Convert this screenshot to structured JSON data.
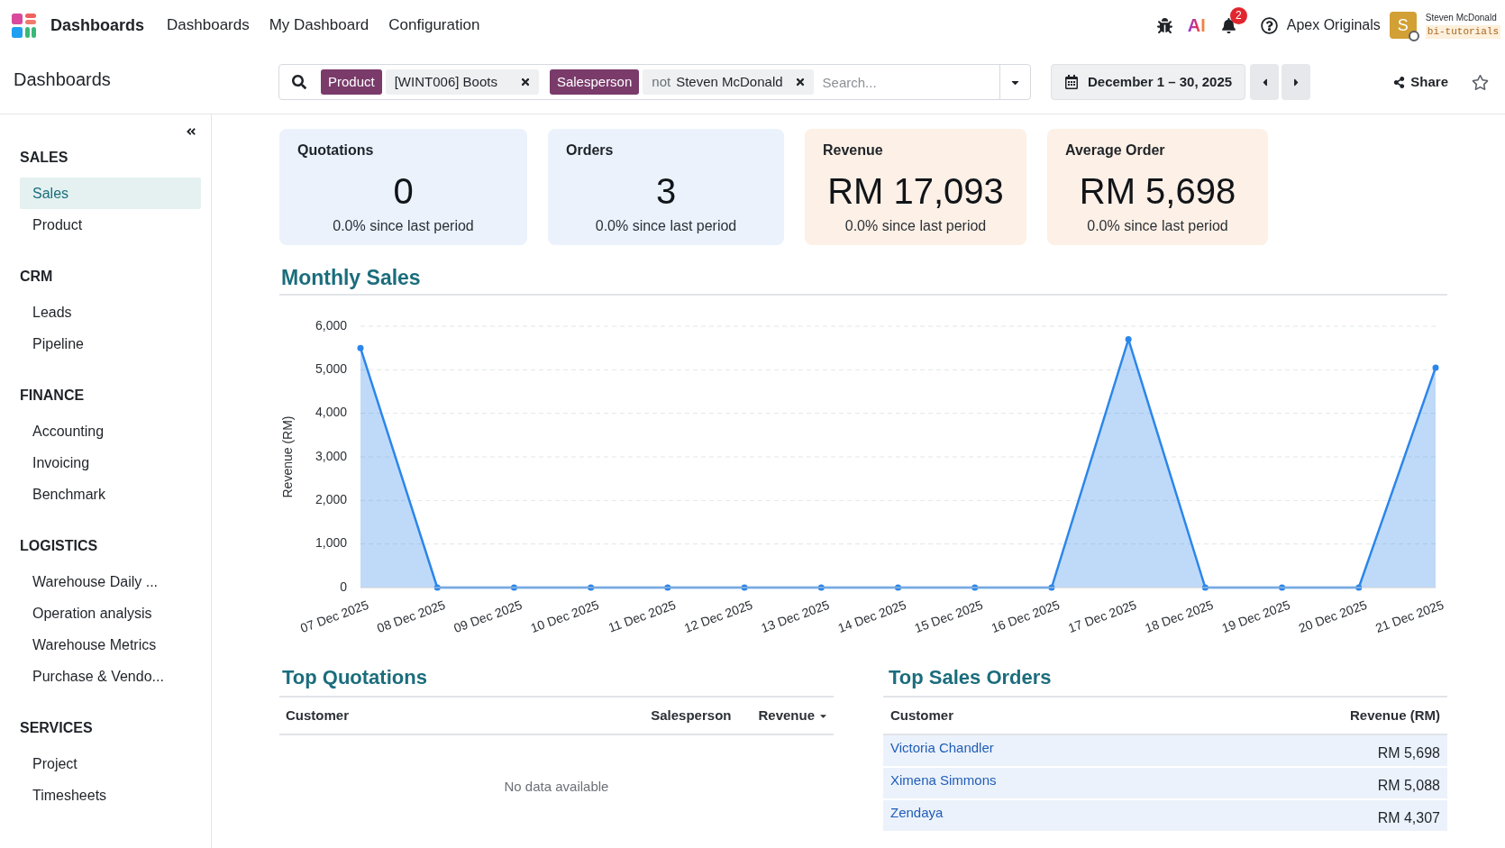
{
  "top_nav": {
    "app_title": "Dashboards",
    "menu": [
      "Dashboards",
      "My Dashboard",
      "Configuration"
    ],
    "ai_label": "AI",
    "notification_count": "2",
    "company": "Apex Originals",
    "user": {
      "avatar_letter": "S",
      "name": "Steven McDonald",
      "database": "bi-tutorials"
    }
  },
  "control_panel": {
    "breadcrumb": "Dashboards",
    "search": {
      "facets": [
        {
          "field": "Product",
          "value": "[WINT006] Boots"
        },
        {
          "field": "Salesperson",
          "operator": "not",
          "value": "Steven McDonald"
        }
      ],
      "placeholder": "Search..."
    },
    "date_range": "December 1 – 30, 2025",
    "share": "Share",
    "starred": false
  },
  "sidebar": {
    "sections": [
      {
        "title": "SALES",
        "items": [
          {
            "label": "Sales",
            "selected": true
          },
          {
            "label": "Product",
            "selected": false
          }
        ]
      },
      {
        "title": "CRM",
        "items": [
          {
            "label": "Leads",
            "selected": false
          },
          {
            "label": "Pipeline",
            "selected": false
          }
        ]
      },
      {
        "title": "FINANCE",
        "items": [
          {
            "label": "Accounting",
            "selected": false
          },
          {
            "label": "Invoicing",
            "selected": false
          },
          {
            "label": "Benchmark",
            "selected": false
          }
        ]
      },
      {
        "title": "LOGISTICS",
        "items": [
          {
            "label": "Warehouse Daily ...",
            "selected": false
          },
          {
            "label": "Operation analysis",
            "selected": false
          },
          {
            "label": "Warehouse Metrics",
            "selected": false
          },
          {
            "label": "Purchase & Vendo...",
            "selected": false
          }
        ]
      },
      {
        "title": "SERVICES",
        "items": [
          {
            "label": "Project",
            "selected": false
          },
          {
            "label": "Timesheets",
            "selected": false
          }
        ]
      }
    ]
  },
  "kpis": [
    {
      "title": "Quotations",
      "value": "0",
      "change": "0.0% since last period",
      "color": "#ebf2fc"
    },
    {
      "title": "Orders",
      "value": "3",
      "change": "0.0% since last period",
      "color": "#ebf2fc"
    },
    {
      "title": "Revenue",
      "value": "RM 17,093",
      "change": "0.0% since last period",
      "color": "#fdf0e6"
    },
    {
      "title": "Average Order",
      "value": "RM 5,698",
      "change": "0.0% since last period",
      "color": "#fdf0e6"
    }
  ],
  "monthly_sales": {
    "title": "Monthly Sales",
    "chart_data": {
      "type": "area",
      "ylabel": "Revenue (RM)",
      "categories": [
        "07 Dec 2025",
        "08 Dec 2025",
        "09 Dec 2025",
        "10 Dec 2025",
        "11 Dec 2025",
        "12 Dec 2025",
        "13 Dec 2025",
        "14 Dec 2025",
        "15 Dec 2025",
        "16 Dec 2025",
        "17 Dec 2025",
        "18 Dec 2025",
        "19 Dec 2025",
        "20 Dec 2025",
        "21 Dec 2025"
      ],
      "series": [
        {
          "color": "#2b86ea",
          "values": [
            5500,
            0,
            0,
            0,
            0,
            0,
            0,
            0,
            0,
            0,
            5700,
            0,
            0,
            0,
            5050
          ]
        }
      ],
      "ylim": [
        0,
        6000
      ],
      "yticks": [
        {
          "value": 0,
          "label": "0"
        },
        {
          "value": 1000,
          "label": "1,000"
        },
        {
          "value": 2000,
          "label": "2,000"
        },
        {
          "value": 3000,
          "label": "3,000"
        },
        {
          "value": 4000,
          "label": "4,000"
        },
        {
          "value": 5000,
          "label": "5,000"
        },
        {
          "value": 6000,
          "label": "6,000"
        }
      ],
      "grid": true
    }
  },
  "top_quotations": {
    "title": "Top Quotations",
    "columns": [
      {
        "label": "Customer",
        "sorted": false
      },
      {
        "label": "Salesperson",
        "sorted": false
      },
      {
        "label": "Revenue",
        "sorted": true
      }
    ],
    "empty_message": "No data available"
  },
  "top_sales_orders": {
    "title": "Top Sales Orders",
    "columns": [
      "Customer",
      "Revenue (RM)"
    ],
    "rows": [
      {
        "customer": "Victoria Chandler",
        "revenue": "RM 5,698"
      },
      {
        "customer": "Ximena Simmons",
        "revenue": "RM 5,088"
      },
      {
        "customer": "Zendaya",
        "revenue": "RM 4,307"
      }
    ]
  }
}
